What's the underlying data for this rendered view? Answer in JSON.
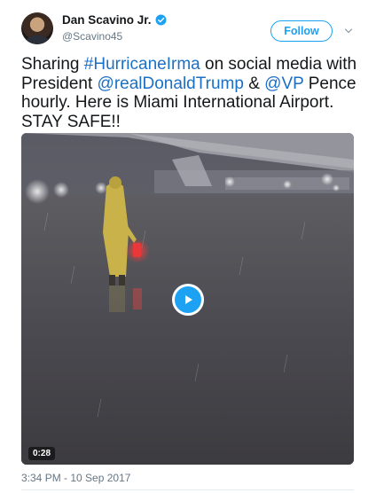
{
  "user": {
    "display_name": "Dan Scavino Jr.",
    "handle": "@Scavino45",
    "verified": true,
    "avatar_icon": "profile-photo"
  },
  "follow_button": {
    "label": "Follow"
  },
  "menu": {
    "icon": "chevron-down-icon"
  },
  "tweet": {
    "parts": [
      "Sharing ",
      "#HurricaneIrma",
      " on social media with President ",
      "@realDonaldTrump",
      " & ",
      "@VP",
      " Pence hourly. Here is Miami International Airport. STAY SAFE!!"
    ],
    "timestamp": "3:34 PM - 10 Sep 2017"
  },
  "video": {
    "duration": "0:28",
    "play_icon": "play-icon"
  },
  "colors": {
    "accent": "#1da1f2",
    "link": "#1b6fc4",
    "text": "#14171a",
    "muted": "#657786"
  }
}
